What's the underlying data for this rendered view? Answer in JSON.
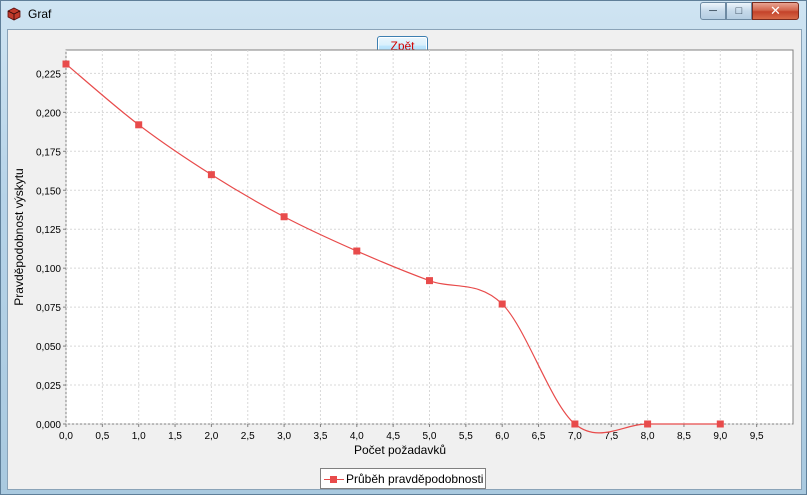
{
  "window": {
    "title": "Graf",
    "minimize_label": "─",
    "maximize_label": "□",
    "close_label": "✕"
  },
  "toolbar": {
    "back_label": "Zpět"
  },
  "colors": {
    "series": "#e84b4b",
    "grid": "#d8d8d8",
    "plot_background": "#ffffff"
  },
  "chart_data": {
    "type": "line",
    "title": "",
    "xlabel": "Počet požadavků",
    "ylabel": "Pravděpodobnost výskytu",
    "xlim": [
      0,
      10
    ],
    "ylim": [
      0,
      0.24
    ],
    "x_ticks": [
      "0,0",
      "0,5",
      "1,0",
      "1,5",
      "2,0",
      "2,5",
      "3,0",
      "3,5",
      "4,0",
      "4,5",
      "5,0",
      "5,5",
      "6,0",
      "6,5",
      "7,0",
      "7,5",
      "8,0",
      "8,5",
      "9,0",
      "9,5"
    ],
    "y_ticks": [
      "0,000",
      "0,025",
      "0,050",
      "0,075",
      "0,100",
      "0,125",
      "0,150",
      "0,175",
      "0,200",
      "0,225"
    ],
    "grid": true,
    "legend_position": "bottom",
    "series": [
      {
        "name": "Průběh pravděpodobnosti",
        "x": [
          0,
          1,
          2,
          3,
          4,
          5,
          6,
          7,
          8,
          9
        ],
        "y": [
          0.231,
          0.192,
          0.16,
          0.133,
          0.111,
          0.092,
          0.077,
          0.0,
          0.0,
          0.0
        ]
      }
    ]
  }
}
